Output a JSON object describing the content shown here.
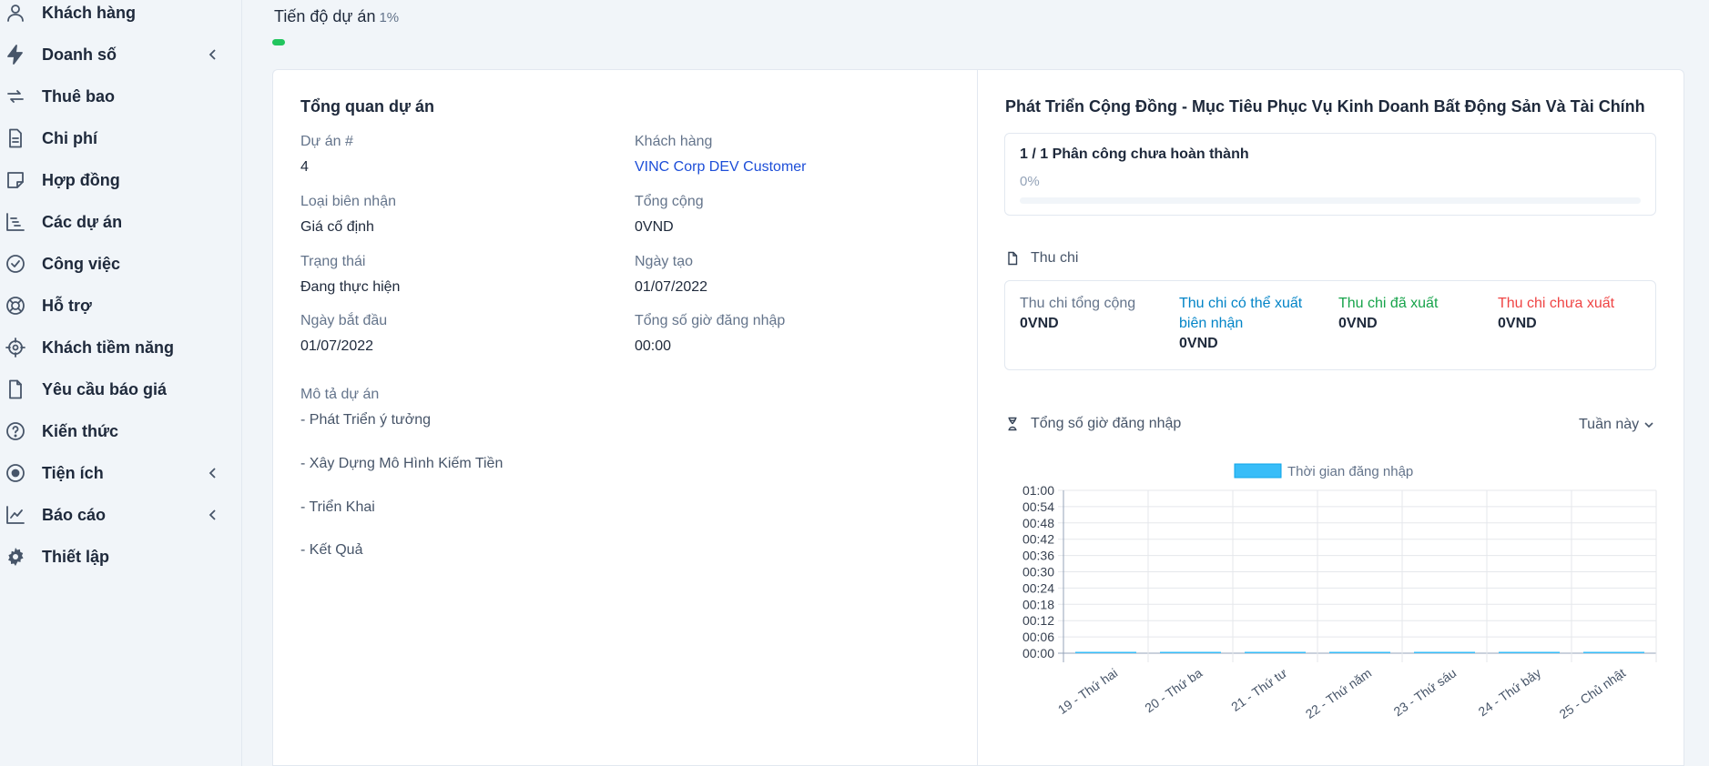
{
  "sidebar": {
    "items": [
      {
        "label": "Khách hàng",
        "icon": "user-icon",
        "chevron": false
      },
      {
        "label": "Doanh số",
        "icon": "bolt-icon",
        "chevron": true
      },
      {
        "label": "Thuê bao",
        "icon": "repeat-icon",
        "chevron": false
      },
      {
        "label": "Chi phí",
        "icon": "document-icon",
        "chevron": false
      },
      {
        "label": "Hợp đồng",
        "icon": "sticky-note-icon",
        "chevron": false
      },
      {
        "label": "Các dự án",
        "icon": "bars-staggered-icon",
        "chevron": false
      },
      {
        "label": "Công việc",
        "icon": "check-circle-icon",
        "chevron": false
      },
      {
        "label": "Hỗ trợ",
        "icon": "life-ring-icon",
        "chevron": false
      },
      {
        "label": "Khách tiềm năng",
        "icon": "crosshair-icon",
        "chevron": false
      },
      {
        "label": "Yêu cầu báo giá",
        "icon": "file-icon",
        "chevron": false
      },
      {
        "label": "Kiến thức",
        "icon": "question-circle-icon",
        "chevron": false
      },
      {
        "label": "Tiện ích",
        "icon": "dot-circle-icon",
        "chevron": true
      },
      {
        "label": "Báo cáo",
        "icon": "chart-line-icon",
        "chevron": true
      },
      {
        "label": "Thiết lập",
        "icon": "gear-icon",
        "chevron": false
      }
    ]
  },
  "progress": {
    "title": "Tiến độ dự án",
    "percent": "1%",
    "value": 0.01,
    "color": "#22c55e"
  },
  "overview": {
    "title": "Tổng quan dự án",
    "fields": {
      "project_no": {
        "label": "Dự án #",
        "value": "4"
      },
      "customer": {
        "label": "Khách hàng",
        "value": "VINC Corp DEV Customer"
      },
      "billing_type": {
        "label": "Loại biên nhận",
        "value": "Giá cố định"
      },
      "total": {
        "label": "Tổng cộng",
        "value": "0VND"
      },
      "status": {
        "label": "Trạng thái",
        "value": "Đang thực hiện"
      },
      "created": {
        "label": "Ngày tạo",
        "value": "01/07/2022"
      },
      "start_date": {
        "label": "Ngày bắt đầu",
        "value": "01/07/2022"
      },
      "logged_hours": {
        "label": "Tổng số giờ đăng nhập",
        "value": "00:00"
      }
    },
    "description_label": "Mô tả dự án",
    "description_lines": [
      "- Phát Triển ý tưởng",
      "- Xây Dựng Mô Hình Kiếm Tiền",
      "- Triển Khai",
      "- Kết Quả"
    ]
  },
  "project": {
    "title": "Phát Triển Cộng Đồng - Mục Tiêu Phục Vụ Kinh Doanh Bất Động Sản Và Tài Chính",
    "tasks": {
      "title": "1 / 1 Phân công chưa hoàn thành",
      "percent": "0%"
    },
    "finance": {
      "title": "Thu chi",
      "items": [
        {
          "label": "Thu chi tổng cộng",
          "value": "0VND",
          "color": "#64748b"
        },
        {
          "label": "Thu chi có thể xuất biên nhận",
          "value": "0VND",
          "color": "#0284c7"
        },
        {
          "label": "Thu chi đã xuất",
          "value": "0VND",
          "color": "#16a34a"
        },
        {
          "label": "Thu chi chưa xuất",
          "value": "0VND",
          "color": "#ef4444"
        }
      ]
    },
    "hours": {
      "title": "Tổng số giờ đăng nhập",
      "period": "Tuần này"
    }
  },
  "chart_data": {
    "type": "bar",
    "title": "",
    "legend": {
      "label": "Thời gian đăng nhập",
      "position": "top"
    },
    "categories": [
      "19 - Thứ hai",
      "20 - Thứ ba",
      "21 - Thứ tư",
      "22 - Thứ năm",
      "23 - Thứ sáu",
      "24 - Thứ bảy",
      "25 - Chủ nhật"
    ],
    "series": [
      {
        "name": "Thời gian đăng nhập",
        "values": [
          0,
          0,
          0,
          0,
          0,
          0,
          0
        ],
        "color": "#38bdf8"
      }
    ],
    "y_ticks": [
      "00:00",
      "00:06",
      "00:12",
      "00:18",
      "00:24",
      "00:30",
      "00:36",
      "00:42",
      "00:48",
      "00:54",
      "01:00"
    ],
    "ylim": [
      0,
      60
    ],
    "grid": true
  }
}
